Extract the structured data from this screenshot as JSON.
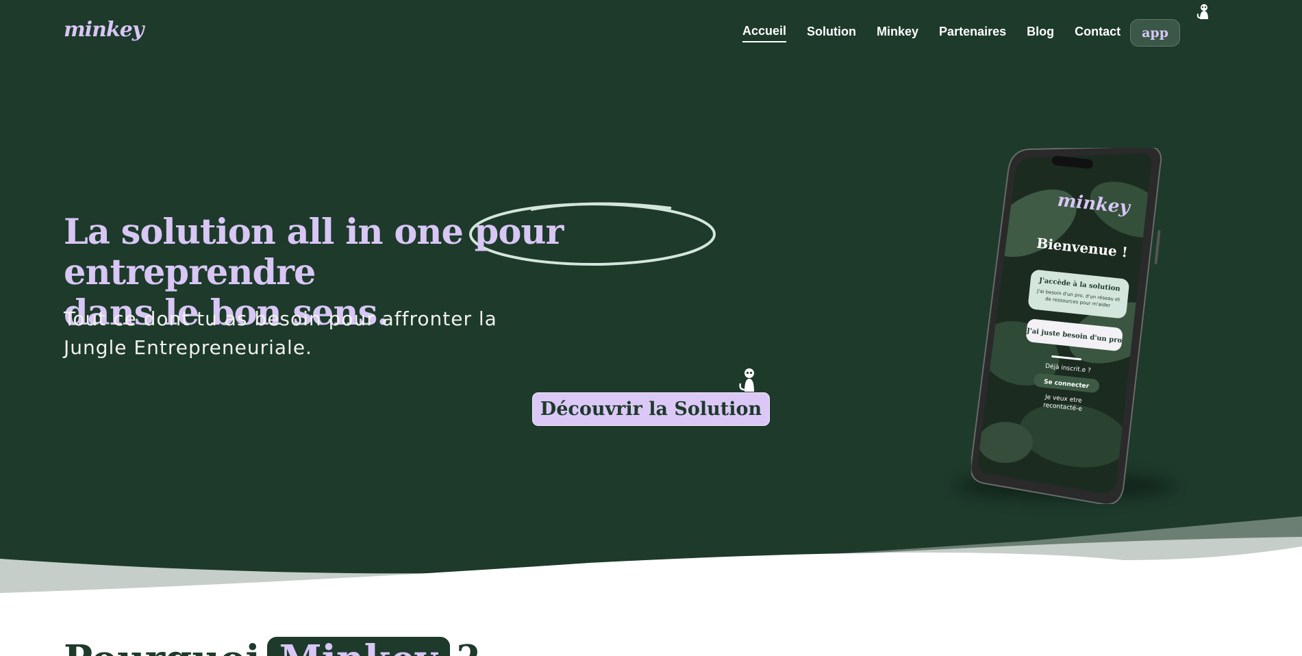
{
  "logo": {
    "text": "minkey"
  },
  "nav": {
    "links": [
      {
        "label": "Accueil",
        "active": true
      },
      {
        "label": "Solution",
        "active": false
      },
      {
        "label": "Minkey",
        "active": false
      },
      {
        "label": "Partenaires",
        "active": false
      },
      {
        "label": "Blog",
        "active": false
      },
      {
        "label": "Contact",
        "active": false
      }
    ],
    "app_label": "app"
  },
  "hero": {
    "headline_part1": "La solution all in one pour ",
    "headline_highlight": "entreprendre",
    "headline_part2": "dans le bon sens.",
    "subtitle": "Tout ce dont tu as besoin pour affronter la Jungle Entrepreneuriale.",
    "cta_label": "Découvrir la Solution"
  },
  "phone": {
    "logo": "minkey",
    "welcome": "Bienvenue !",
    "option1_title": "J'accède à la solution",
    "option1_text_line1": "J'ai besoin d'un pro, d'un réseau et",
    "option1_text_line2": "de ressources pour m'aider",
    "option2_title": "J'ai juste besoin d'un pro",
    "already_registered": "Déjà inscrit.e ?",
    "login": "Se connecter",
    "contact_line1": "Je veux etre",
    "contact_line2": "recontacté-e"
  },
  "next_section": {
    "title_start": "Pourquoi",
    "title_pill": "Minkey",
    "title_end": "?"
  },
  "colors": {
    "dark_green": "#1d3a2b",
    "lavender": "#d8c6f4",
    "mint": "#d4e6dc",
    "wave_mid": "#6b7f72",
    "wave_light": "#c5cec8"
  }
}
